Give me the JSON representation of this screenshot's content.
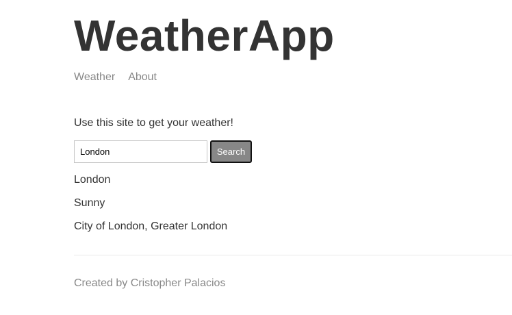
{
  "header": {
    "title": "WeatherApp",
    "nav": [
      {
        "label": "Weather"
      },
      {
        "label": "About"
      }
    ]
  },
  "main": {
    "intro": "Use this site to get your weather!",
    "search": {
      "value": "London",
      "button_label": "Search"
    },
    "results": {
      "city": "London",
      "condition": "Sunny",
      "region": "City of London, Greater London"
    }
  },
  "footer": {
    "text": "Created by Cristopher Palacios"
  },
  "colors": {
    "text": "#333333",
    "muted": "#888888",
    "button_bg": "#878787",
    "button_border": "#111111"
  }
}
